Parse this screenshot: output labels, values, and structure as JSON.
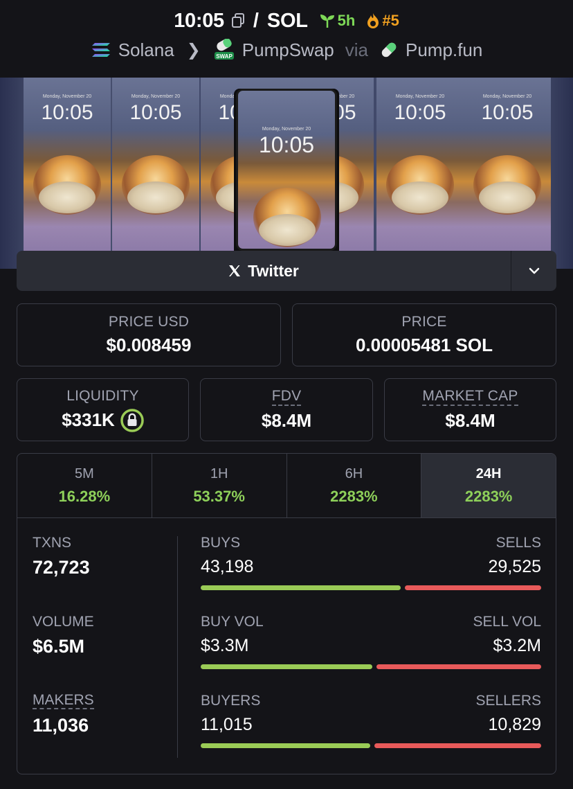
{
  "header": {
    "pair_symbol": "10:05",
    "slash": "/",
    "quote": "SOL",
    "age": "5h",
    "rank": "#5",
    "chain": "Solana",
    "dex": "PumpSwap",
    "via": "via",
    "launchpad": "Pump.fun",
    "colors": {
      "age": "#7ed957",
      "rank": "#f0a020"
    }
  },
  "banner": {
    "clock": "10:05",
    "date": "Monday, November 20"
  },
  "twitter": {
    "label": "Twitter"
  },
  "prices": {
    "price_usd_label": "PRICE USD",
    "price_usd_value": "$0.008459",
    "price_label": "PRICE",
    "price_value": "0.00005481 SOL"
  },
  "metrics": {
    "liquidity_label": "LIQUIDITY",
    "liquidity_value": "$331K",
    "fdv_label": "FDV",
    "fdv_value": "$8.4M",
    "mcap_label": "MARKET CAP",
    "mcap_value": "$8.4M"
  },
  "timeframes": [
    {
      "label": "5M",
      "change": "16.28%"
    },
    {
      "label": "1H",
      "change": "53.37%"
    },
    {
      "label": "6H",
      "change": "2283%"
    },
    {
      "label": "24H",
      "change": "2283%"
    }
  ],
  "stats": {
    "txns_label": "TXNS",
    "txns_value": "72,723",
    "volume_label": "VOLUME",
    "volume_value": "$6.5M",
    "makers_label": "MAKERS",
    "makers_value": "11,036",
    "buys_label": "BUYS",
    "buys_value": "43,198",
    "sells_label": "SELLS",
    "sells_value": "29,525",
    "buys_fraction": 0.594,
    "buy_vol_label": "BUY VOL",
    "buy_vol_value": "$3.3M",
    "sell_vol_label": "SELL VOL",
    "sell_vol_value": "$3.2M",
    "buy_vol_fraction": 0.51,
    "buyers_label": "BUYERS",
    "buyers_value": "11,015",
    "sellers_label": "SELLERS",
    "sellers_value": "10,829",
    "buyers_fraction": 0.504
  },
  "colors": {
    "positive": "#8ed05a",
    "buy_bar": "#9acb56",
    "sell_bar": "#e85a5a"
  }
}
